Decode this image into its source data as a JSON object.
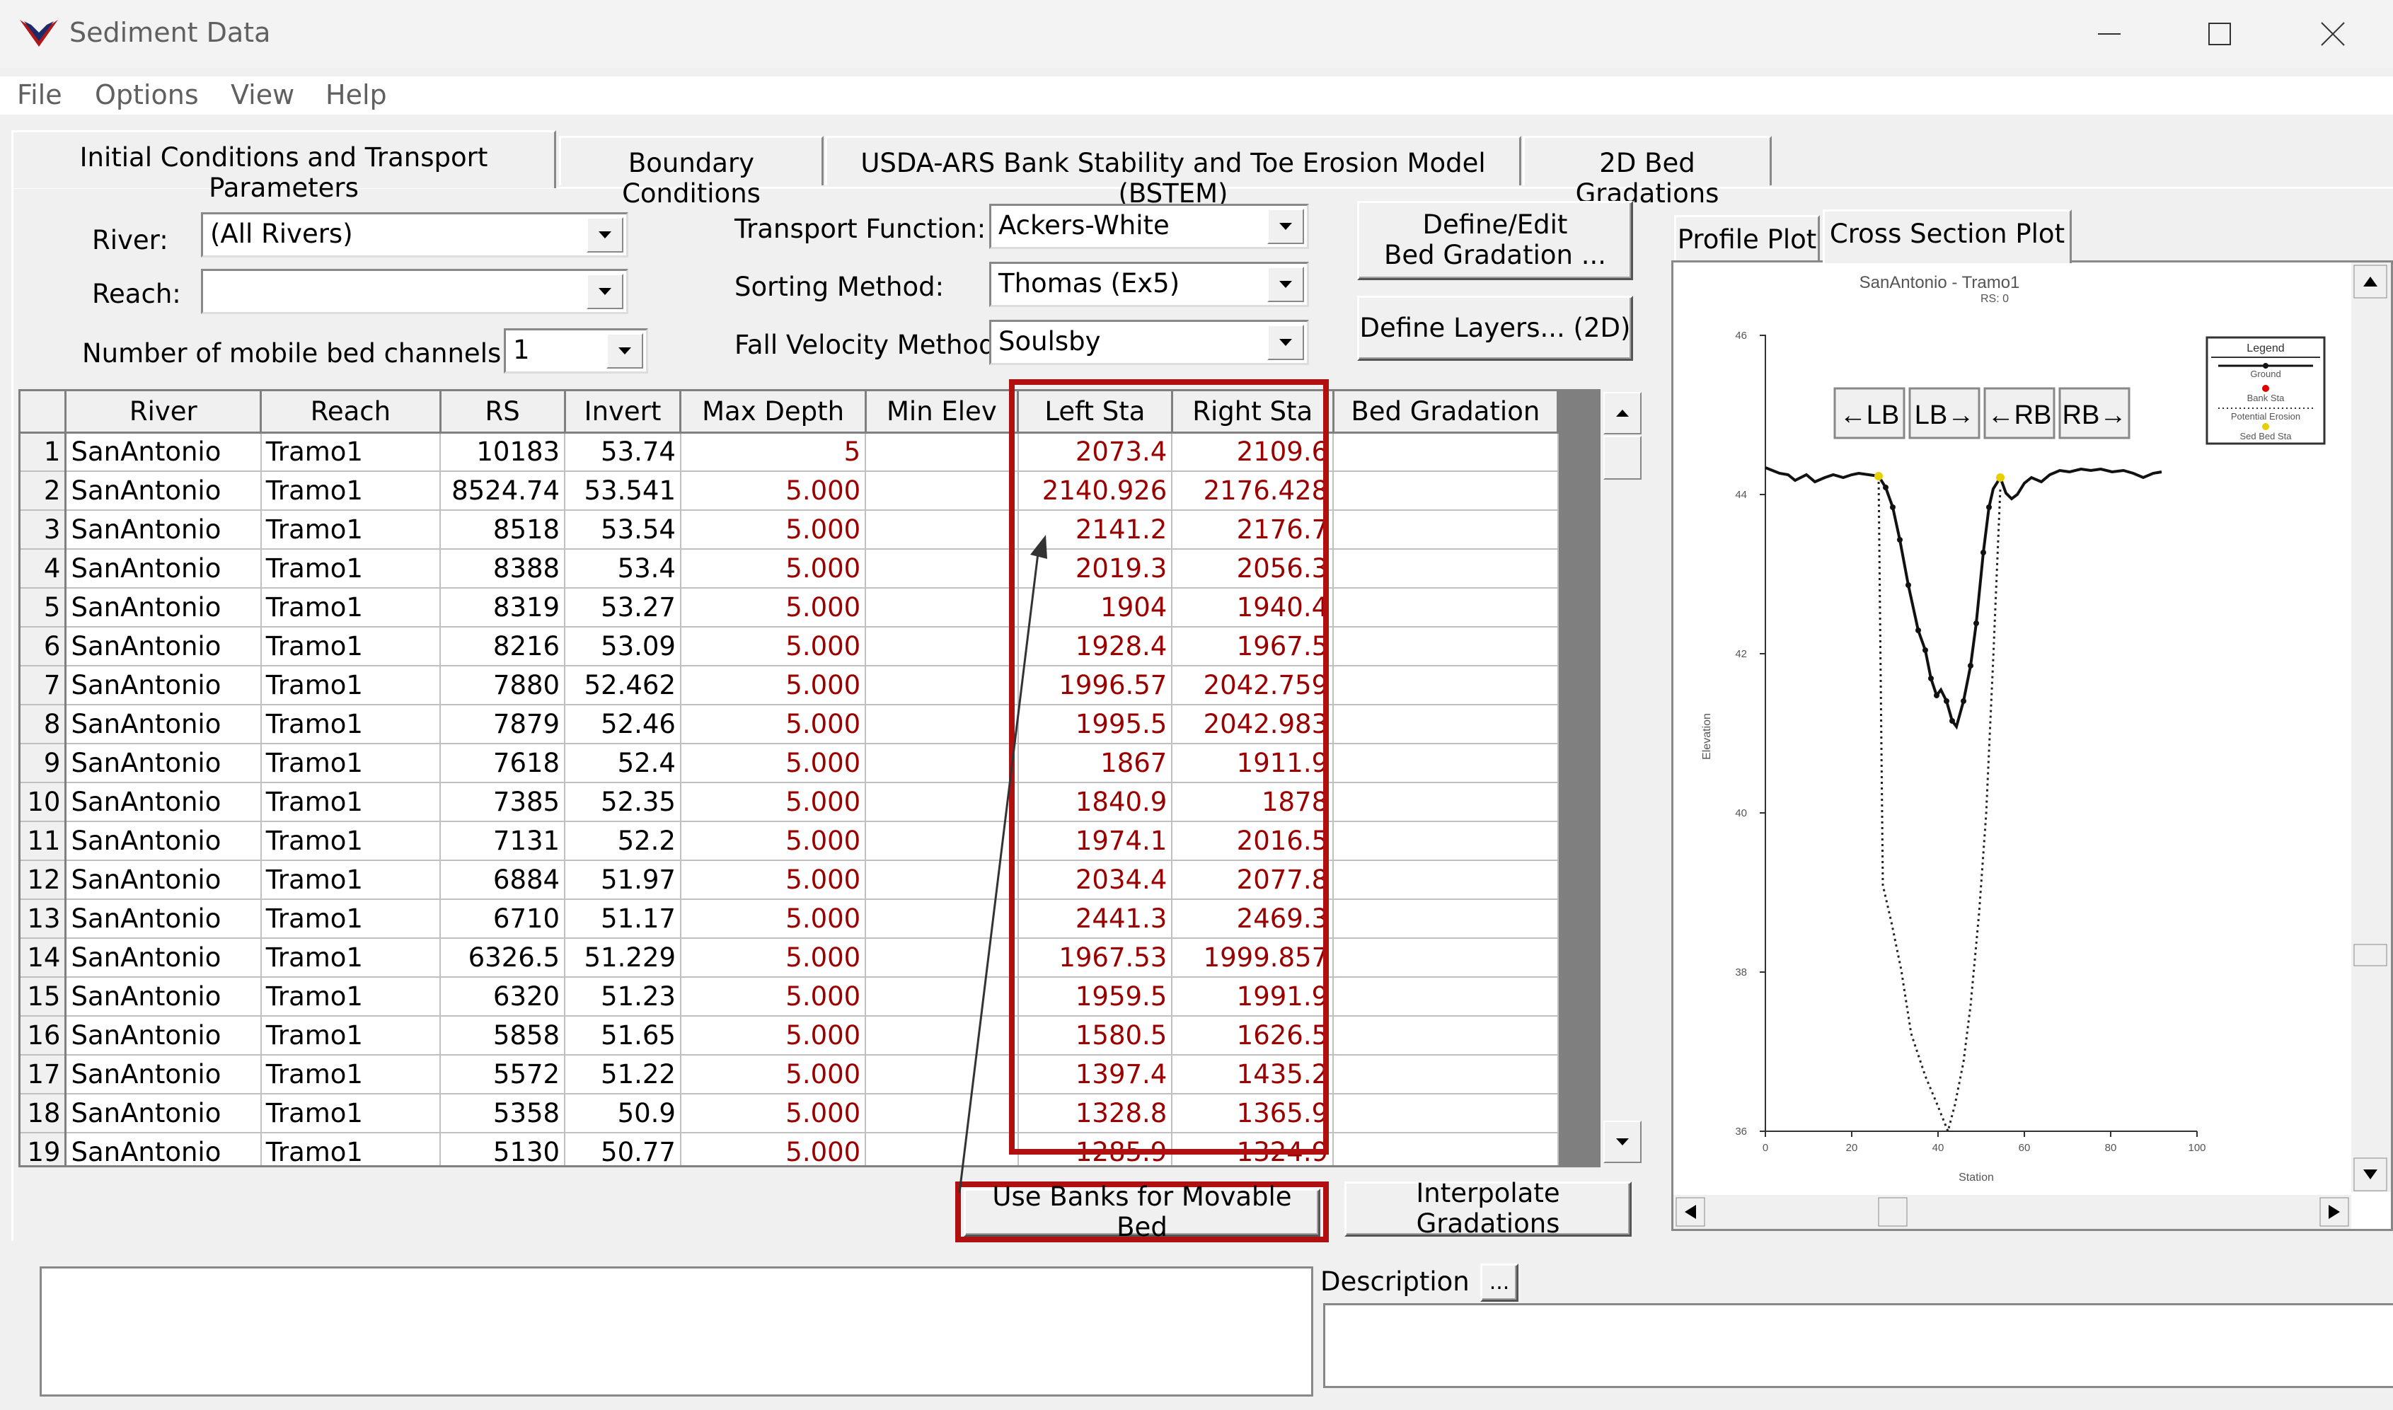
{
  "window": {
    "title": "Sediment Data"
  },
  "menu": [
    "File",
    "Options",
    "View",
    "Help"
  ],
  "tabs": [
    "Initial Conditions and Transport Parameters",
    "Boundary Conditions",
    "USDA-ARS Bank Stability and Toe Erosion Model (BSTEM)",
    "2D Bed Gradations"
  ],
  "controls": {
    "river_label": "River:",
    "river_value": "(All Rivers)",
    "reach_label": "Reach:",
    "reach_value": "",
    "channels_label": "Number of mobile bed channels:",
    "channels_value": "1",
    "transport_label": "Transport Function:",
    "transport_value": "Ackers-White",
    "sorting_label": "Sorting Method:",
    "sorting_value": "Thomas (Ex5)",
    "fall_label": "Fall Velocity Method:",
    "fall_value": "Soulsby",
    "define_gradation_line1": "Define/Edit",
    "define_gradation_line2": "Bed Gradation ...",
    "define_layers": "Define Layers... (2D)",
    "use_banks": "Use Banks for Movable Bed",
    "interpolate": "Interpolate Gradations",
    "description_label": "Description :",
    "ellipsis": "..."
  },
  "table": {
    "columns": [
      "River",
      "Reach",
      "RS",
      "Invert",
      "Max Depth",
      "Min Elev",
      "Left Sta",
      "Right Sta",
      "Bed Gradation"
    ],
    "rows": [
      [
        "1",
        "SanAntonio",
        "Tramo1",
        "10183",
        "53.74",
        "5",
        "",
        "2073.4",
        "2109.6"
      ],
      [
        "2",
        "SanAntonio",
        "Tramo1",
        "8524.74",
        "53.541",
        "5.000",
        "",
        "2140.926",
        "2176.428"
      ],
      [
        "3",
        "SanAntonio",
        "Tramo1",
        "8518",
        "53.54",
        "5.000",
        "",
        "2141.2",
        "2176.7"
      ],
      [
        "4",
        "SanAntonio",
        "Tramo1",
        "8388",
        "53.4",
        "5.000",
        "",
        "2019.3",
        "2056.3"
      ],
      [
        "5",
        "SanAntonio",
        "Tramo1",
        "8319",
        "53.27",
        "5.000",
        "",
        "1904",
        "1940.4"
      ],
      [
        "6",
        "SanAntonio",
        "Tramo1",
        "8216",
        "53.09",
        "5.000",
        "",
        "1928.4",
        "1967.5"
      ],
      [
        "7",
        "SanAntonio",
        "Tramo1",
        "7880",
        "52.462",
        "5.000",
        "",
        "1996.57",
        "2042.759"
      ],
      [
        "8",
        "SanAntonio",
        "Tramo1",
        "7879",
        "52.46",
        "5.000",
        "",
        "1995.5",
        "2042.983"
      ],
      [
        "9",
        "SanAntonio",
        "Tramo1",
        "7618",
        "52.4",
        "5.000",
        "",
        "1867",
        "1911.9"
      ],
      [
        "10",
        "SanAntonio",
        "Tramo1",
        "7385",
        "52.35",
        "5.000",
        "",
        "1840.9",
        "1878"
      ],
      [
        "11",
        "SanAntonio",
        "Tramo1",
        "7131",
        "52.2",
        "5.000",
        "",
        "1974.1",
        "2016.5"
      ],
      [
        "12",
        "SanAntonio",
        "Tramo1",
        "6884",
        "51.97",
        "5.000",
        "",
        "2034.4",
        "2077.8"
      ],
      [
        "13",
        "SanAntonio",
        "Tramo1",
        "6710",
        "51.17",
        "5.000",
        "",
        "2441.3",
        "2469.3"
      ],
      [
        "14",
        "SanAntonio",
        "Tramo1",
        "6326.5",
        "51.229",
        "5.000",
        "",
        "1967.53",
        "1999.857"
      ],
      [
        "15",
        "SanAntonio",
        "Tramo1",
        "6320",
        "51.23",
        "5.000",
        "",
        "1959.5",
        "1991.9"
      ],
      [
        "16",
        "SanAntonio",
        "Tramo1",
        "5858",
        "51.65",
        "5.000",
        "",
        "1580.5",
        "1626.5"
      ],
      [
        "17",
        "SanAntonio",
        "Tramo1",
        "5572",
        "51.22",
        "5.000",
        "",
        "1397.4",
        "1435.2"
      ],
      [
        "18",
        "SanAntonio",
        "Tramo1",
        "5358",
        "50.9",
        "5.000",
        "",
        "1328.8",
        "1365.9"
      ],
      [
        "19",
        "SanAntonio",
        "Tramo1",
        "5130",
        "50.77",
        "5.000",
        "",
        "1285.9",
        "1324.9"
      ]
    ]
  },
  "plot": {
    "tabs": [
      "Profile Plot",
      "Cross Section Plot"
    ],
    "title": "SanAntonio      - Tramo1",
    "subtitle": "RS: 0",
    "ylabel": "Elevation",
    "xlabel": "Station",
    "yticks": [
      "36",
      "38",
      "40",
      "42",
      "44",
      "46"
    ],
    "xticks": [
      "0",
      "20",
      "40",
      "60",
      "80",
      "100"
    ],
    "bank_buttons": [
      "←LB",
      "LB→",
      "←RB",
      "RB→"
    ],
    "legend_title": "Legend",
    "legend": [
      "Ground",
      "Bank Sta",
      "Potential Erosion",
      "Sed Bed Sta"
    ],
    "colors": {
      "bank": "#e00000",
      "sed_bed": "#e8d000"
    }
  },
  "colors": {
    "highlight": "#b01010",
    "value_red": "#9b0000"
  }
}
